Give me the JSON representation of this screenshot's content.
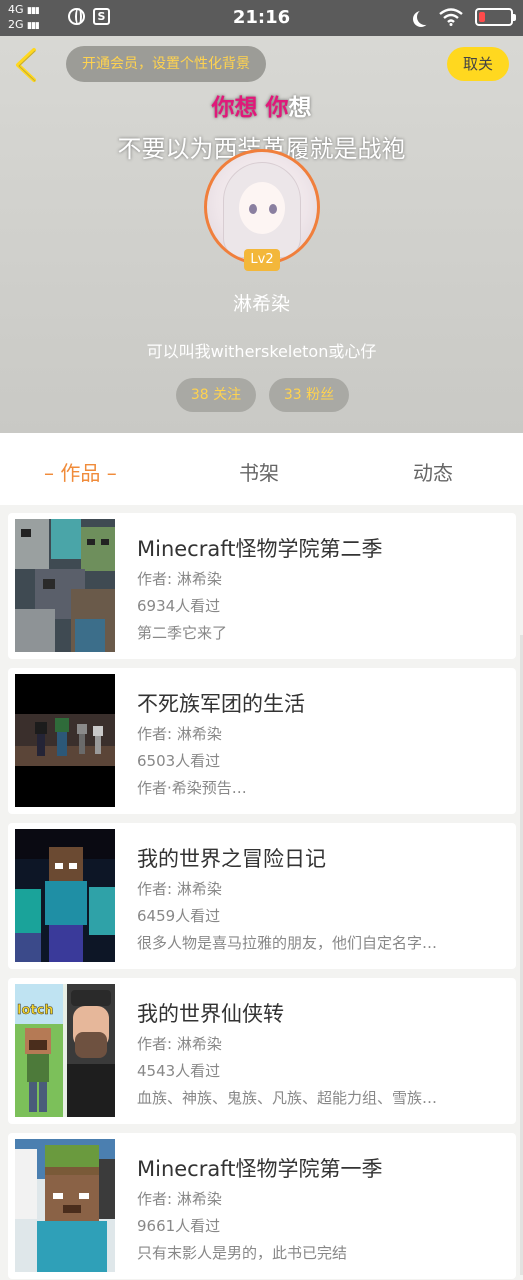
{
  "status_bar": {
    "network_top": "4G",
    "network_bottom": "2G",
    "time": "21:16",
    "icons": [
      "globe-icon",
      "s-app-icon",
      "moon-icon",
      "wifi-icon",
      "battery-icon"
    ],
    "battery_level": 0.2
  },
  "header": {
    "vip_prompt": "开通会员，设置个性化背景",
    "cancel_label": "取关",
    "lyric_highlight": "你想 你",
    "lyric_rest": "想",
    "lyric_line2": "不要以为西装革履就是战袍",
    "level": "Lv2",
    "username": "淋希染",
    "bio": "可以叫我witherskeleton或心仔",
    "follow_count": "38 关注",
    "fans_count": "33 粉丝"
  },
  "tabs": [
    {
      "label": "– 作品 –",
      "active": true
    },
    {
      "label": "书架",
      "active": false
    },
    {
      "label": "动态",
      "active": false
    }
  ],
  "works": [
    {
      "title": "Minecraft怪物学院第二季",
      "author": "作者: 淋希染",
      "views": "6934人看过",
      "desc": "第二季它来了"
    },
    {
      "title": "不死族军团的生活",
      "author": "作者: 淋希染",
      "views": "6503人看过",
      "desc": "作者·希染预告…"
    },
    {
      "title": "我的世界之冒险日记",
      "author": "作者: 淋希染",
      "views": "6459人看过",
      "desc": "很多人物是喜马拉雅的朋友，他们自定名字…"
    },
    {
      "title": "我的世界仙侠转",
      "author": "作者: 淋希染",
      "views": "4543人看过",
      "desc": "血族、神族、鬼族、凡族、超能力组、雪族…"
    },
    {
      "title": "Minecraft怪物学院第一季",
      "author": "作者: 淋希染",
      "views": "9661人看过",
      "desc": "只有末影人是男的，此书已完结"
    }
  ],
  "thumb_text": "lotch",
  "colors": {
    "accent": "#f08b3a",
    "yellow": "#ffd81f",
    "lyric_pink": "#e0197a"
  }
}
